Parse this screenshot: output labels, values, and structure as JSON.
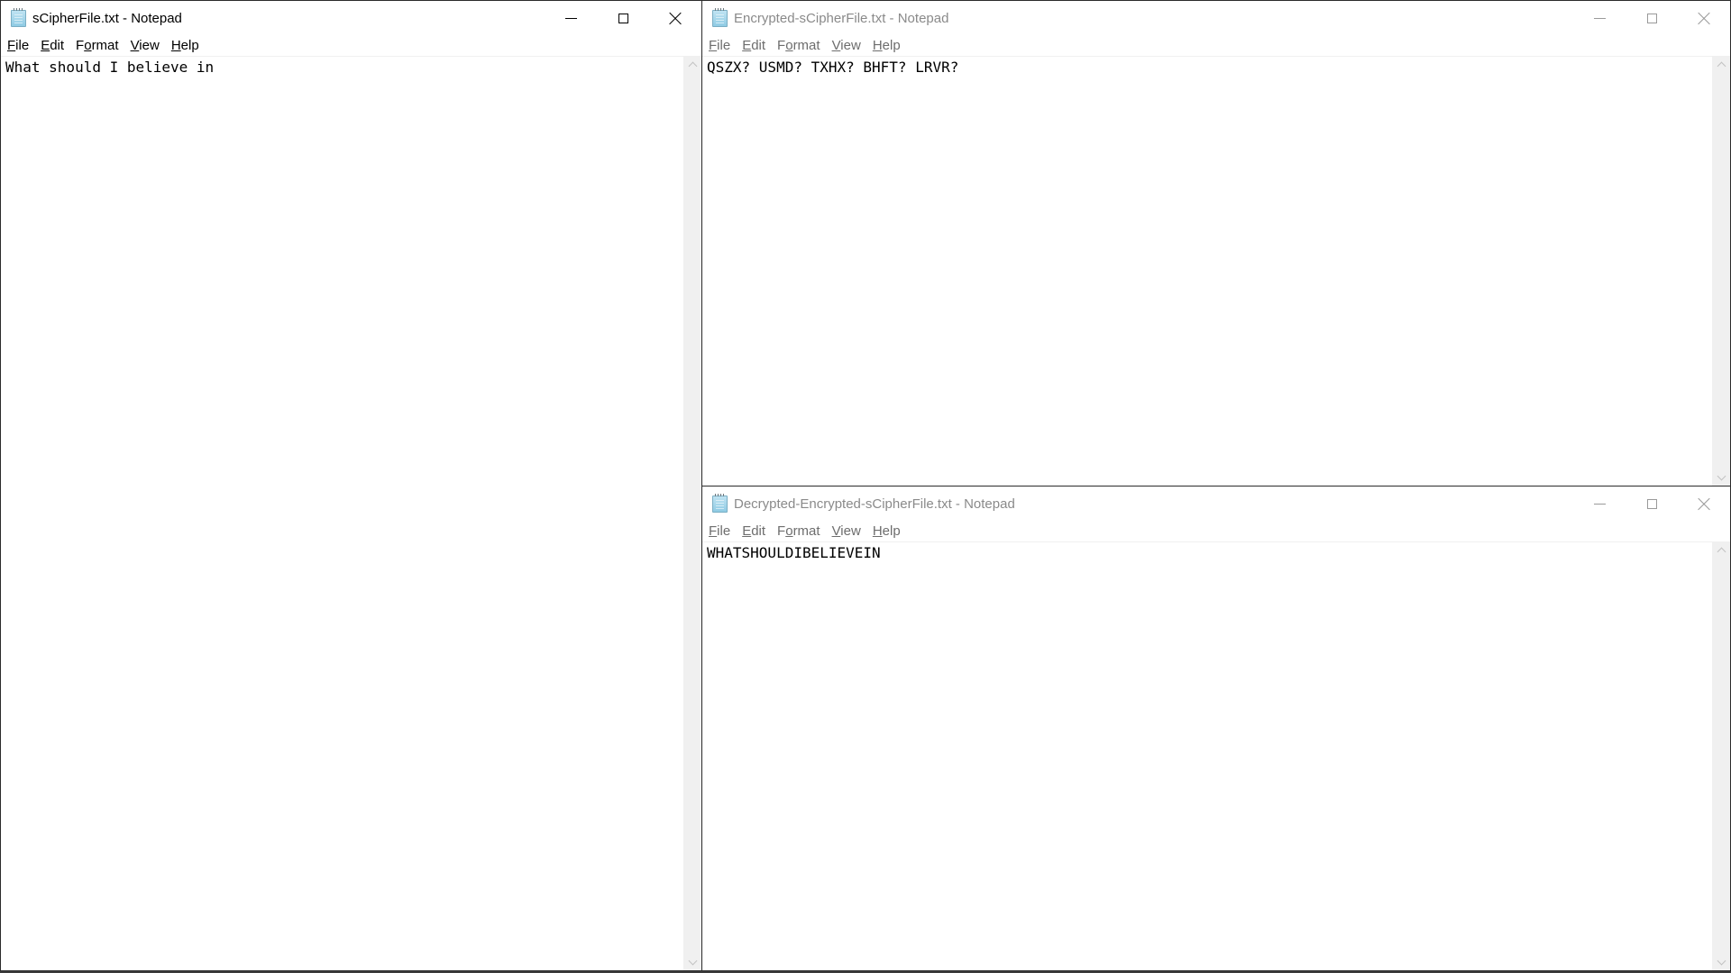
{
  "windows": {
    "left": {
      "title": "sCipherFile.txt - Notepad",
      "content": "What should I believe in",
      "active": true
    },
    "top_right": {
      "title": "Encrypted-sCipherFile.txt - Notepad",
      "content": "QSZX? USMD? TXHX? BHFT? LRVR?",
      "active": false
    },
    "bottom_right": {
      "title": "Decrypted-Encrypted-sCipherFile.txt - Notepad",
      "content": "WHATSHOULDIBELIEVEIN",
      "active": false
    }
  },
  "menu": {
    "items": [
      {
        "label": "File",
        "mnemonic": "F",
        "rest": "ile"
      },
      {
        "label": "Edit",
        "mnemonic": "E",
        "rest": "dit"
      },
      {
        "label": "Format",
        "pre": "F",
        "mnemonic": "o",
        "rest": "rmat"
      },
      {
        "label": "View",
        "mnemonic": "V",
        "rest": "iew"
      },
      {
        "label": "Help",
        "mnemonic": "H",
        "rest": "elp"
      }
    ]
  },
  "icons": {
    "app": "notepad-icon",
    "minimize": "minimize-icon",
    "maximize": "maximize-icon",
    "close": "close-icon",
    "scroll_up": "chevron-up-icon",
    "scroll_down": "chevron-down-icon"
  }
}
